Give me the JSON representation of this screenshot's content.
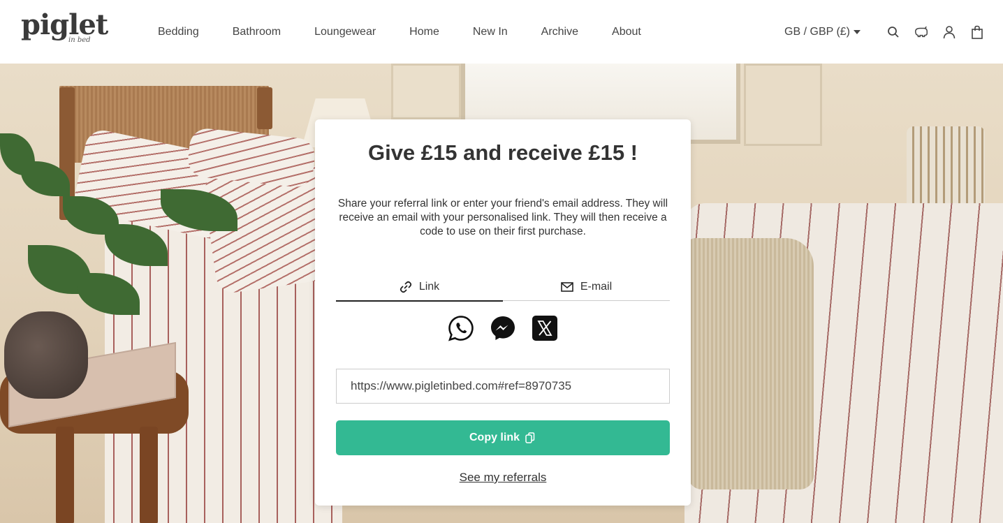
{
  "brand": {
    "logo_main": "piglet",
    "logo_sub": "in bed"
  },
  "nav": {
    "items": [
      {
        "label": "Bedding"
      },
      {
        "label": "Bathroom"
      },
      {
        "label": "Loungewear"
      },
      {
        "label": "Home"
      },
      {
        "label": "New In"
      },
      {
        "label": "Archive"
      },
      {
        "label": "About"
      }
    ]
  },
  "header_right": {
    "currency_label": "GB / GBP (£)",
    "icons": [
      "search-icon",
      "piggy-icon",
      "account-icon",
      "bag-icon"
    ]
  },
  "modal": {
    "title": "Give £15 and receive £15 !",
    "description": "Share your referral link or enter your friend's email address. They will receive an email with your personalised link. They will then receive a code to use on their first purchase.",
    "tabs": [
      {
        "label": "Link",
        "icon": "link-icon",
        "active": true
      },
      {
        "label": "E-mail",
        "icon": "mail-icon",
        "active": false
      }
    ],
    "socials": [
      "whatsapp-icon",
      "messenger-icon",
      "x-icon"
    ],
    "referral_link": "https://www.pigletinbed.com#ref=8970735",
    "copy_label": "Copy link",
    "see_referrals_label": "See my referrals"
  },
  "colors": {
    "accent": "#33b993",
    "text": "#333333"
  }
}
